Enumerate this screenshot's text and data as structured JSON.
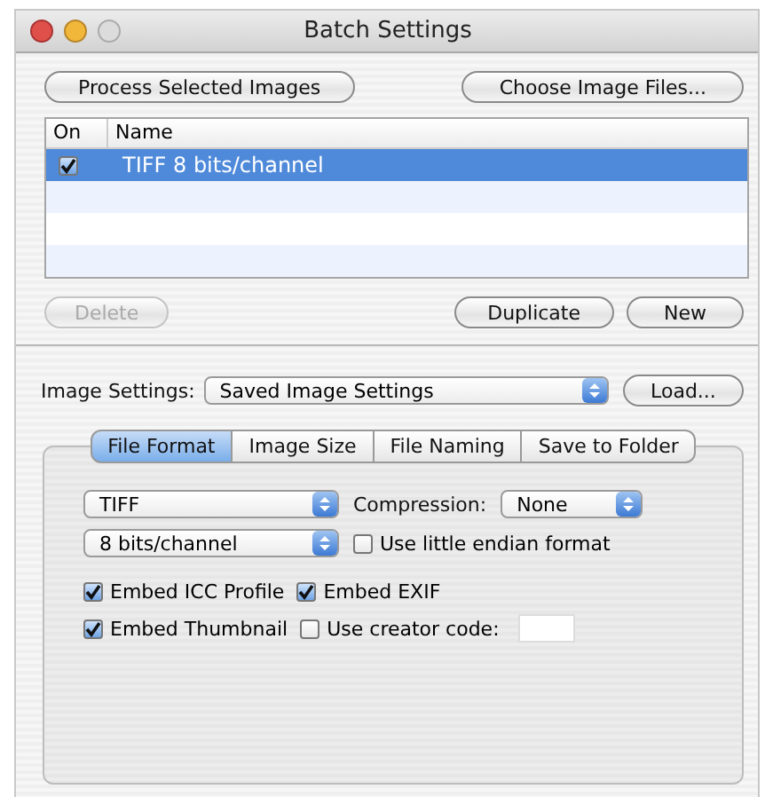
{
  "window": {
    "title": "Batch Settings"
  },
  "top_buttons": [
    {
      "label": "Process Selected Images"
    },
    {
      "label": "Choose Image Files..."
    }
  ],
  "table": {
    "columns": [
      "On",
      "Name"
    ],
    "rows": [
      {
        "on": true,
        "name": "TIFF 8 bits/channel",
        "selected": true
      }
    ]
  },
  "list_buttons": [
    {
      "label": "Delete",
      "disabled": true
    },
    {
      "label": "Duplicate",
      "disabled": false
    },
    {
      "label": "New",
      "disabled": false
    }
  ],
  "image_settings": {
    "label": "Image Settings:",
    "value": "Saved Image Settings",
    "button": "Load..."
  },
  "tabs": [
    {
      "label": "File Format",
      "selected": true
    },
    {
      "label": "Image Size",
      "selected": false
    },
    {
      "label": "File Naming",
      "selected": false
    },
    {
      "label": "Save to Folder",
      "selected": false
    }
  ],
  "file_format": {
    "format": "TIFF",
    "compression_label": "Compression:",
    "compression": "None",
    "bit_depth": "8 bits/channel",
    "little_endian": {
      "label": "Use little endian format",
      "checked": false
    },
    "options": [
      [
        {
          "label": "Embed ICC Profile",
          "checked": true
        },
        {
          "label": "Embed EXIF",
          "checked": true
        }
      ],
      [
        {
          "label": "Embed Thumbnail",
          "checked": true
        },
        {
          "label": "Use creator code:",
          "checked": false
        }
      ]
    ]
  }
}
